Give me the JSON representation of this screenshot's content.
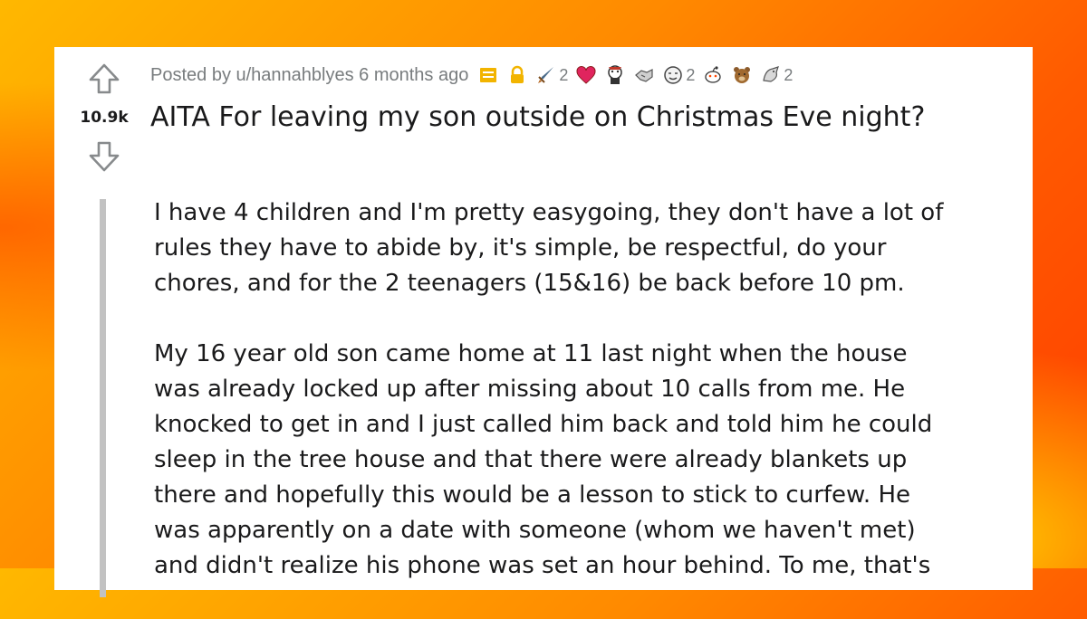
{
  "post": {
    "score": "10.9k",
    "meta_text": "Posted by u/hannahblyes 6 months ago",
    "title": "AITA For leaving my son outside on Christmas Eve night?",
    "awards": [
      {
        "icon": "archive-icon",
        "count": ""
      },
      {
        "icon": "lock-icon",
        "count": ""
      },
      {
        "icon": "sword-award-icon",
        "count": "2"
      },
      {
        "icon": "heart-award-icon",
        "count": ""
      },
      {
        "icon": "wholesome-award-icon",
        "count": ""
      },
      {
        "icon": "handshake-award-icon",
        "count": ""
      },
      {
        "icon": "face-award-icon",
        "count": "2"
      },
      {
        "icon": "snoo-award-icon",
        "count": ""
      },
      {
        "icon": "bear-award-icon",
        "count": ""
      },
      {
        "icon": "dragon-award-icon",
        "count": "2"
      }
    ],
    "paragraphs": [
      "I have 4 children and I'm pretty easygoing, they don't have a lot of\nrules they have to abide by, it's simple, be respectful, do your\nchores, and for the 2 teenagers (15&16) be back before 10 pm.",
      "My 16 year old son came home at 11 last night when the house\nwas already locked up after missing about 10 calls from me. He\nknocked to get in and I just called him back and told him he could\nsleep in the tree house and that there were already blankets up\nthere and hopefully this would be a lesson to stick to curfew. He\nwas apparently on a date with someone (whom we haven't met)\nand didn't realize his phone was set an hour behind. To me, that's"
    ]
  },
  "colors": {
    "background_top": "#ffb800",
    "background_bottom": "#ff3d00",
    "card": "#ffffff",
    "text": "#1a1a1b",
    "meta": "#787c7e",
    "quote_bar": "#c2c2c2"
  }
}
